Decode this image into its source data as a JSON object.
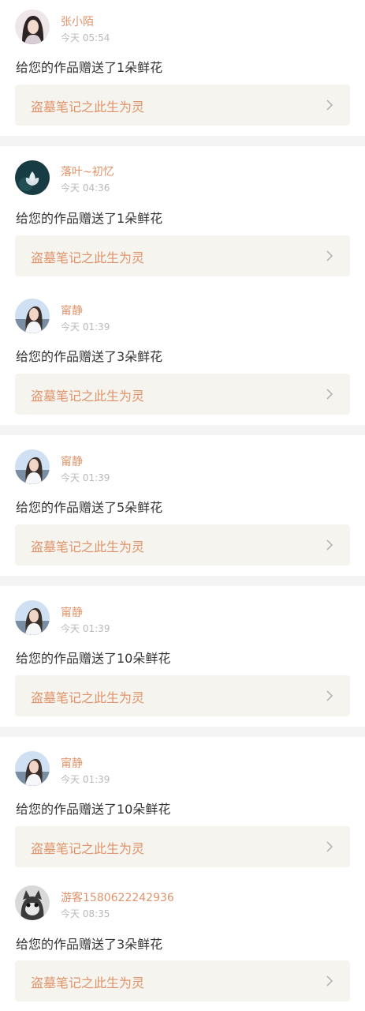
{
  "items": [
    {
      "username": "张小陌",
      "time": "今天 05:54",
      "message": "给您的作品赠送了1朵鲜花",
      "book_title": "盗墓笔记之此生为灵",
      "chevron_icon": "chevron-right-icon",
      "avatar_icon": "avatar-girl-icon"
    },
    {
      "username": "落叶~初忆",
      "time": "今天 04:36",
      "message": "给您的作品赠送了1朵鲜花",
      "book_title": "盗墓笔记之此生为灵",
      "chevron_icon": "chevron-right-icon",
      "avatar_icon": "avatar-lotus-icon"
    },
    {
      "username": "甯静",
      "time": "今天 01:39",
      "message": "给您的作品赠送了3朵鲜花",
      "book_title": "盗墓笔记之此生为灵",
      "chevron_icon": "chevron-right-icon",
      "avatar_icon": "avatar-girl-blue-icon"
    },
    {
      "username": "甯静",
      "time": "今天 01:39",
      "message": "给您的作品赠送了5朵鲜花",
      "book_title": "盗墓笔记之此生为灵",
      "chevron_icon": "chevron-right-icon",
      "avatar_icon": "avatar-girl-blue-icon"
    },
    {
      "username": "甯静",
      "time": "今天 01:39",
      "message": "给您的作品赠送了10朵鲜花",
      "book_title": "盗墓笔记之此生为灵",
      "chevron_icon": "chevron-right-icon",
      "avatar_icon": "avatar-girl-blue-icon"
    },
    {
      "username": "甯静",
      "time": "今天 01:39",
      "message": "给您的作品赠送了10朵鲜花",
      "book_title": "盗墓笔记之此生为灵",
      "chevron_icon": "chevron-right-icon",
      "avatar_icon": "avatar-girl-blue-icon"
    },
    {
      "username": "游客1580622242936",
      "time": "今天 08:35",
      "message": "给您的作品赠送了3朵鲜花",
      "book_title": "盗墓笔记之此生为灵",
      "chevron_icon": "chevron-right-icon",
      "avatar_icon": "avatar-cat-icon"
    }
  ],
  "colors": {
    "accent": "#e0936a",
    "book_card_bg": "#f5f4ee",
    "page_bg": "#f4f4f4",
    "text": "#333333",
    "time": "#b9b9b9"
  }
}
